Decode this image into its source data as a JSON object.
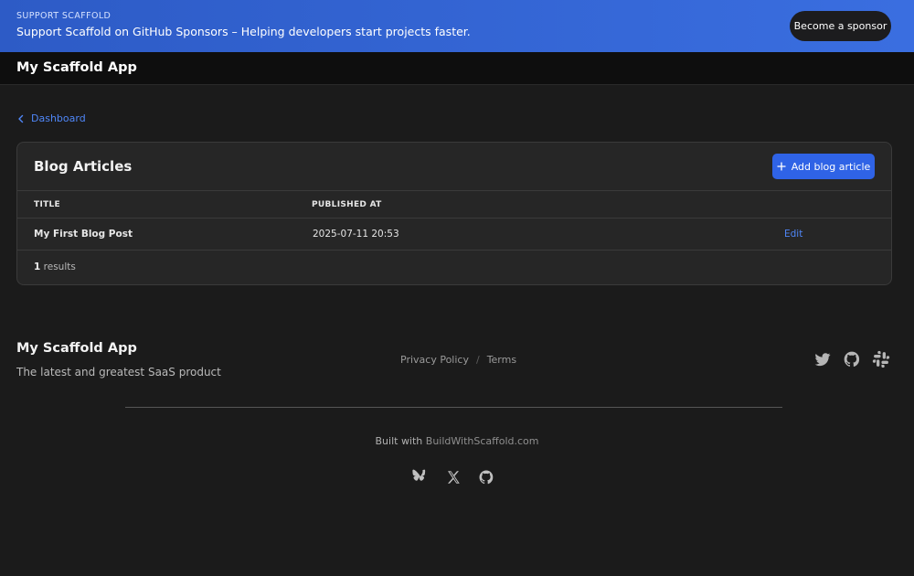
{
  "banner": {
    "kicker": "SUPPORT SCAFFOLD",
    "text": "Support Scaffold on GitHub Sponsors – Helping developers start projects faster.",
    "button_label": "Become a sponsor",
    "gradient_start": "#2d5bc6",
    "gradient_end": "#3a6ee0"
  },
  "header": {
    "app_title": "My Scaffold App"
  },
  "breadcrumb": {
    "back_label": "Dashboard",
    "icon": "chevron-left-icon"
  },
  "card": {
    "title": "Blog Articles",
    "add_button_label": "Add blog article",
    "columns": [
      "TITLE",
      "PUBLISHED AT"
    ],
    "rows": [
      {
        "title": "My First Blog Post",
        "published_at": "2025-07-11 20:53",
        "action": "Edit"
      }
    ],
    "results_count": "1",
    "results_label": " results"
  },
  "footer": {
    "title": "My Scaffold App",
    "tagline": "The latest and greatest SaaS product",
    "links": [
      "Privacy Policy",
      "Terms"
    ],
    "separator": "/",
    "social_icons": [
      "twitter-icon",
      "github-icon",
      "slack-icon"
    ],
    "built_prefix": "Built with ",
    "built_link": "BuildWithScaffold.com",
    "bottom_icons": [
      "bluesky-icon",
      "x-icon",
      "github-icon"
    ]
  },
  "colors": {
    "accent": "#2f63e6",
    "link": "#4f86f7",
    "background": "#1b1b1b",
    "card": "#262626"
  }
}
